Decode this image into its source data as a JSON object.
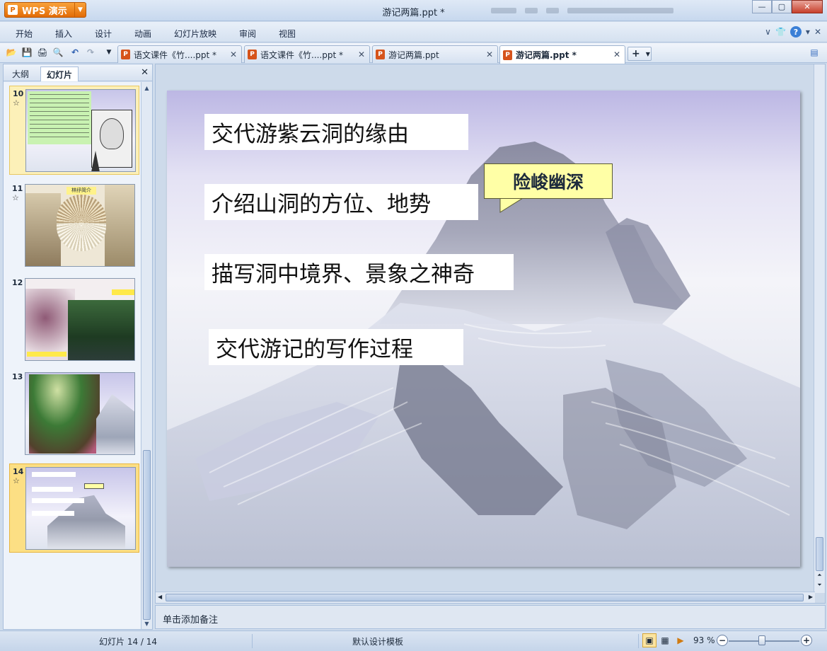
{
  "app": {
    "name": "WPS 演示",
    "window_title": "游记两篇.ppt *"
  },
  "menu": [
    "开始",
    "插入",
    "设计",
    "动画",
    "幻灯片放映",
    "审阅",
    "视图"
  ],
  "tabs": [
    {
      "label": "语文课件《竹....ppt *",
      "active": false
    },
    {
      "label": "语文课件《竹....ppt *",
      "active": false
    },
    {
      "label": "游记两篇.ppt",
      "active": false
    },
    {
      "label": "游记两篇.ppt *",
      "active": true
    }
  ],
  "left_pane": {
    "tabs": [
      "大纲",
      "幻灯片"
    ],
    "active_tab": "幻灯片",
    "thumbnails": [
      {
        "number": "10",
        "star": "☆",
        "caption": ""
      },
      {
        "number": "11",
        "star": "☆",
        "caption": "林纾简介"
      },
      {
        "number": "12",
        "star": "",
        "caption": ""
      },
      {
        "number": "13",
        "star": "",
        "caption": ""
      },
      {
        "number": "14",
        "star": "☆",
        "caption": "",
        "selected": true
      }
    ]
  },
  "slide": {
    "lines": [
      "交代游紫云洞的缘由",
      "介绍山洞的方位、地势",
      "描写洞中境界、景象之神奇",
      "交代游记的写作过程"
    ],
    "callout": "险峻幽深"
  },
  "notes_placeholder": "单击添加备注",
  "status": {
    "slide_counter": "幻灯片 14 / 14",
    "template": "默认设计模板",
    "zoom": "93 %"
  }
}
